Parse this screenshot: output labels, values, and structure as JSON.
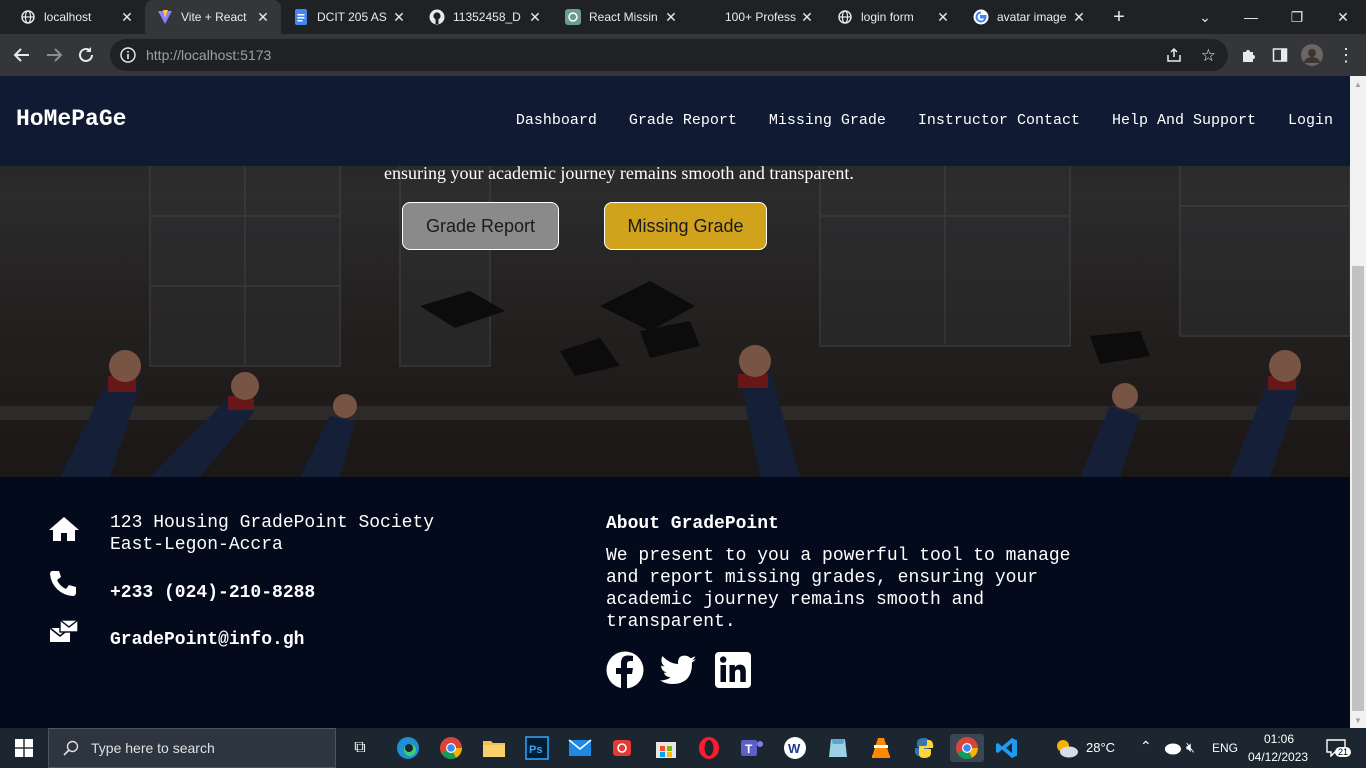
{
  "browser": {
    "tabs": [
      {
        "title": "localhost",
        "icon": "globe-icon"
      },
      {
        "title": "Vite + React",
        "icon": "vite-icon"
      },
      {
        "title": "DCIT 205 AS",
        "icon": "docs-icon"
      },
      {
        "title": "11352458_D",
        "icon": "github-icon"
      },
      {
        "title": "React Missin",
        "icon": "chatgpt-icon"
      },
      {
        "title": "100+ Profess",
        "icon": "blank-icon"
      },
      {
        "title": "login form",
        "icon": "globe-icon"
      },
      {
        "title": "avatar image",
        "icon": "google-icon"
      }
    ],
    "new_tab": "+",
    "url_host": "http://localhost",
    "url_port": ":5173"
  },
  "site": {
    "brand": "HoMePaGe",
    "nav": [
      "Dashboard",
      "Grade Report",
      "Missing Grade",
      "Instructor Contact",
      "Help And Support",
      "Login"
    ],
    "hero_text": "ensuring your academic journey remains smooth and transparent.",
    "btn_grade_report": "Grade Report",
    "btn_missing_grade": "Missing Grade"
  },
  "footer": {
    "address_line1": "123 Housing GradePoint Society",
    "address_line2": "East-Legon-Accra",
    "phone": "+233 (024)-210-8288",
    "email": "GradePoint@info.gh",
    "about_title": "About GradePoint",
    "about_text": "We present to you a powerful tool to manage and report missing grades, ensuring your academic journey remains smooth and transparent.",
    "social": [
      "facebook-icon",
      "twitter-icon",
      "linkedin-icon"
    ]
  },
  "taskbar": {
    "search_placeholder": "Type here to search",
    "weather": "28°C",
    "lang": "ENG",
    "time": "01:06",
    "date": "04/12/2023",
    "notifications": "21"
  },
  "colors": {
    "navbar": "#101a33",
    "footer": "#030a1b",
    "btn_grade": "#8a8a8a",
    "btn_missing": "#d1a21c"
  }
}
